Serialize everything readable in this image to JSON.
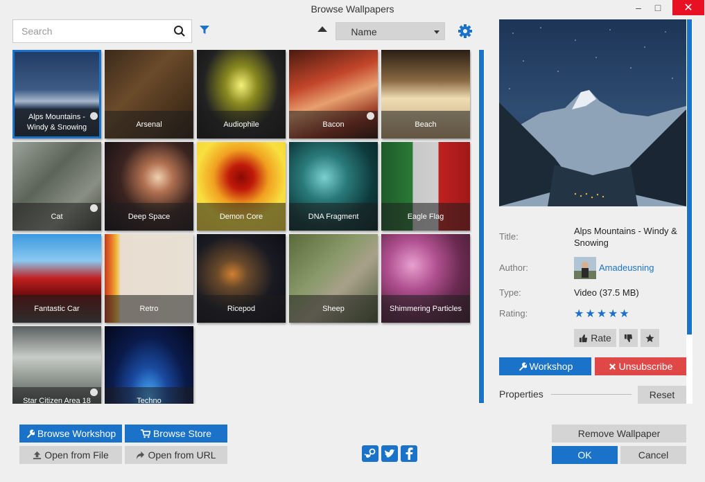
{
  "window": {
    "title": "Browse Wallpapers",
    "minimize": "–",
    "maximize": "□",
    "close": "✕"
  },
  "search": {
    "placeholder": "Search",
    "value": ""
  },
  "sort": {
    "direction": "ascending",
    "selected": "Name"
  },
  "tiles": [
    {
      "label": "Alps Mountains - Windy & Snowing",
      "selected": true,
      "workshop": true
    },
    {
      "label": "Arsenal",
      "workshop": false
    },
    {
      "label": "Audiophile",
      "workshop": false
    },
    {
      "label": "Bacon",
      "workshop": true
    },
    {
      "label": "Beach",
      "workshop": false
    },
    {
      "label": "Cat",
      "workshop": true
    },
    {
      "label": "Deep Space",
      "workshop": false
    },
    {
      "label": "Demon Core",
      "workshop": false
    },
    {
      "label": "DNA Fragment",
      "workshop": false
    },
    {
      "label": "Eagle Flag",
      "workshop": false
    },
    {
      "label": "Fantastic Car",
      "workshop": false
    },
    {
      "label": "Retro",
      "workshop": false
    },
    {
      "label": "Ricepod",
      "workshop": false
    },
    {
      "label": "Sheep",
      "workshop": false
    },
    {
      "label": "Shimmering Particles",
      "workshop": false
    },
    {
      "label": "Star Citizen Area 18",
      "workshop": true
    },
    {
      "label": "Techno",
      "workshop": false
    }
  ],
  "details": {
    "title_label": "Title:",
    "title_value": "Alps Mountains - Windy & Snowing",
    "author_label": "Author:",
    "author_value": "Amadeusning",
    "type_label": "Type:",
    "type_value": "Video (37.5 MB)",
    "rating_label": "Rating:",
    "rating_stars": "★★★★★",
    "rate_button": "Rate",
    "workshop_button": "Workshop",
    "unsubscribe_button": "Unsubscribe",
    "properties_label": "Properties",
    "reset_button": "Reset"
  },
  "footer": {
    "browse_workshop": "Browse Workshop",
    "browse_store": "Browse Store",
    "open_from_file": "Open from File",
    "open_from_url": "Open from URL",
    "remove_wallpaper": "Remove Wallpaper",
    "ok": "OK",
    "cancel": "Cancel"
  },
  "colors": {
    "accent": "#1a73c8",
    "danger": "#e04848",
    "close": "#e81123",
    "button_gray": "#d4d4d4"
  }
}
